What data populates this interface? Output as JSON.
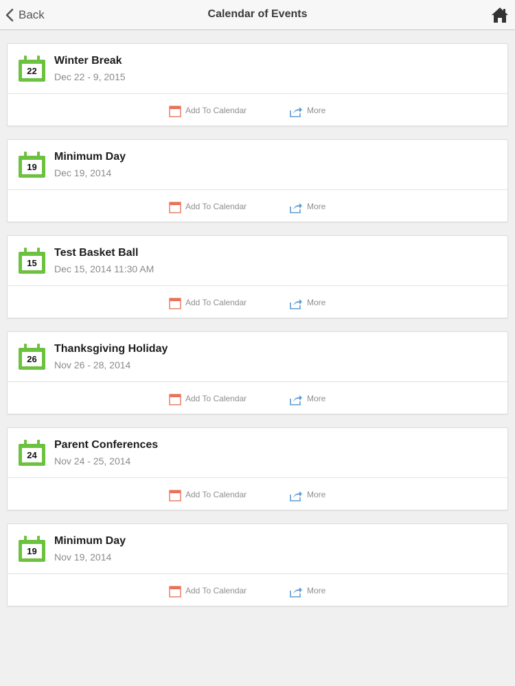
{
  "navbar": {
    "back_label": "Back",
    "title": "Calendar of Events",
    "home_icon": "home-icon",
    "back_icon": "chevron-left-icon"
  },
  "actions": {
    "add_to_calendar": "Add To Calendar",
    "more": "More"
  },
  "colors": {
    "accent_green": "#6bc23e",
    "add_calendar_red": "#e8735a",
    "more_blue": "#5b9bd5"
  },
  "events": [
    {
      "day": "22",
      "title": "Winter Break",
      "date": "Dec 22 - 9, 2015"
    },
    {
      "day": "19",
      "title": "Minimum Day",
      "date": "Dec 19, 2014"
    },
    {
      "day": "15",
      "title": "Test Basket Ball",
      "date": "Dec 15, 2014 11:30 AM"
    },
    {
      "day": "26",
      "title": "Thanksgiving Holiday",
      "date": "Nov 26 - 28, 2014"
    },
    {
      "day": "24",
      "title": "Parent Conferences",
      "date": "Nov 24 - 25, 2014"
    },
    {
      "day": "19",
      "title": "Minimum Day",
      "date": "Nov 19, 2014"
    }
  ]
}
